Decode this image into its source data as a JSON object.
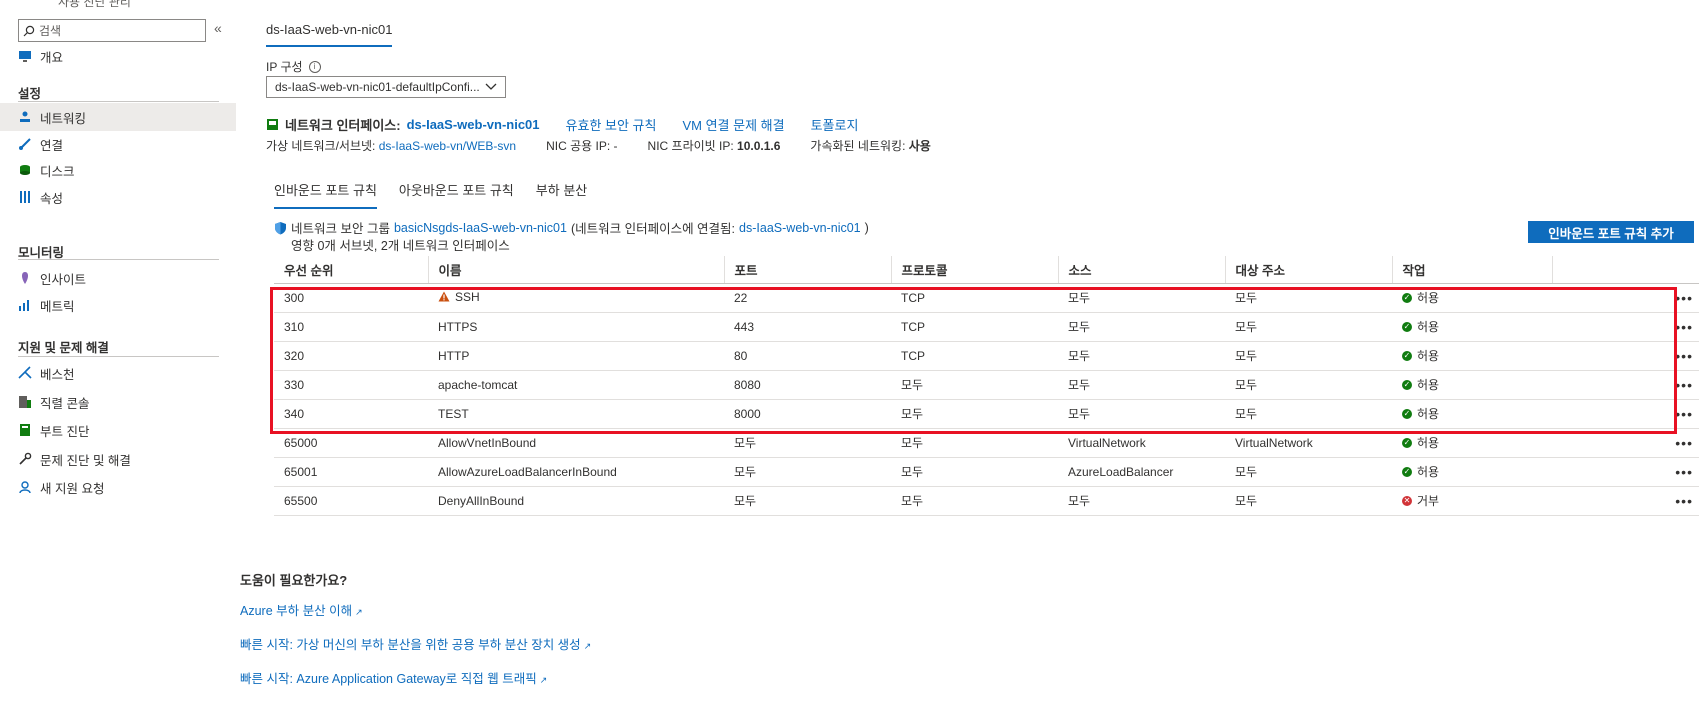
{
  "sidebar": {
    "top_cut_text": "사용 진단 관리",
    "search_placeholder": "검색",
    "collapse_glyph": "«",
    "overview": "개요",
    "settings_title": "설정",
    "settings_items": [
      "네트워킹",
      "연결",
      "디스크",
      "속성"
    ],
    "monitoring_title": "모니터링",
    "monitoring_items": [
      "인사이트",
      "메트릭"
    ],
    "support_title": "지원 및 문제 해결",
    "support_items": [
      "베스천",
      "직렬 콘솔",
      "부트 진단",
      "문제 진단 및 해결",
      "새 지원 요청"
    ]
  },
  "header": {
    "resource_tab": "ds-IaaS-web-vn-nic01",
    "ip_config_label": "IP 구성",
    "ip_config_value": "ds-IaaS-web-vn-nic01-defaultIpConfi..."
  },
  "nic": {
    "label": "네트워크 인터페이스:",
    "name": "ds-IaaS-web-vn-nic01",
    "actions": [
      "유효한 보안 규칙",
      "VM 연결 문제 해결",
      "토폴로지"
    ],
    "vnet_label": "가상 네트워크/서브넷:",
    "vnet_value": "ds-IaaS-web-vn/WEB-svn",
    "public_ip_label": "NIC 공용 IP:",
    "public_ip_value": "-",
    "private_ip_label": "NIC 프라이빗 IP:",
    "private_ip_value": "10.0.1.6",
    "accel_label": "가속화된 네트워킹:",
    "accel_value": "사용"
  },
  "tabs": [
    "인바운드 포트 규칙",
    "아웃바운드 포트 규칙",
    "부하 분산"
  ],
  "nsg": {
    "prefix": "네트워크 보안 그룹",
    "name": "basicNsgds-IaaS-web-vn-nic01",
    "attached_prefix": "(네트워크 인터페이스에 연결됨:",
    "attached_name": "ds-IaaS-web-vn-nic01",
    "attached_suffix": ")",
    "impact": "영향 0개 서브넷, 2개 네트워크 인터페이스",
    "add_button": "인바운드 포트 규칙 추가"
  },
  "table": {
    "columns": [
      "우선 순위",
      "이름",
      "포트",
      "프로토콜",
      "소스",
      "대상 주소",
      "작업"
    ],
    "rows": [
      {
        "priority": "300",
        "name": "SSH",
        "port": "22",
        "protocol": "TCP",
        "source": "모두",
        "dest": "모두",
        "action": "허용",
        "warn": true
      },
      {
        "priority": "310",
        "name": "HTTPS",
        "port": "443",
        "protocol": "TCP",
        "source": "모두",
        "dest": "모두",
        "action": "허용"
      },
      {
        "priority": "320",
        "name": "HTTP",
        "port": "80",
        "protocol": "TCP",
        "source": "모두",
        "dest": "모두",
        "action": "허용"
      },
      {
        "priority": "330",
        "name": "apache-tomcat",
        "port": "8080",
        "protocol": "모두",
        "source": "모두",
        "dest": "모두",
        "action": "허용"
      },
      {
        "priority": "340",
        "name": "TEST",
        "port": "8000",
        "protocol": "모두",
        "source": "모두",
        "dest": "모두",
        "action": "허용"
      },
      {
        "priority": "65000",
        "name": "AllowVnetInBound",
        "port": "모두",
        "protocol": "모두",
        "source": "VirtualNetwork",
        "dest": "VirtualNetwork",
        "action": "허용"
      },
      {
        "priority": "65001",
        "name": "AllowAzureLoadBalancerInBound",
        "port": "모두",
        "protocol": "모두",
        "source": "AzureLoadBalancer",
        "dest": "모두",
        "action": "허용"
      },
      {
        "priority": "65500",
        "name": "DenyAllInBound",
        "port": "모두",
        "protocol": "모두",
        "source": "모두",
        "dest": "모두",
        "action": "거부",
        "deny": true
      }
    ],
    "more_glyph": "•••"
  },
  "help": {
    "title": "도움이 필요한가요?",
    "links": [
      "Azure 부하 분산 이해",
      "빠른 시작: 가상 머신의 부하 분산을 위한 공용 부하 분산 장치 생성",
      "빠른 시작: Azure Application Gateway로 직접 웹 트래픽"
    ]
  },
  "colors": {
    "accent": "#0f6cbd",
    "highlight": "#e81123",
    "allow": "#107c10",
    "deny": "#d13438"
  }
}
